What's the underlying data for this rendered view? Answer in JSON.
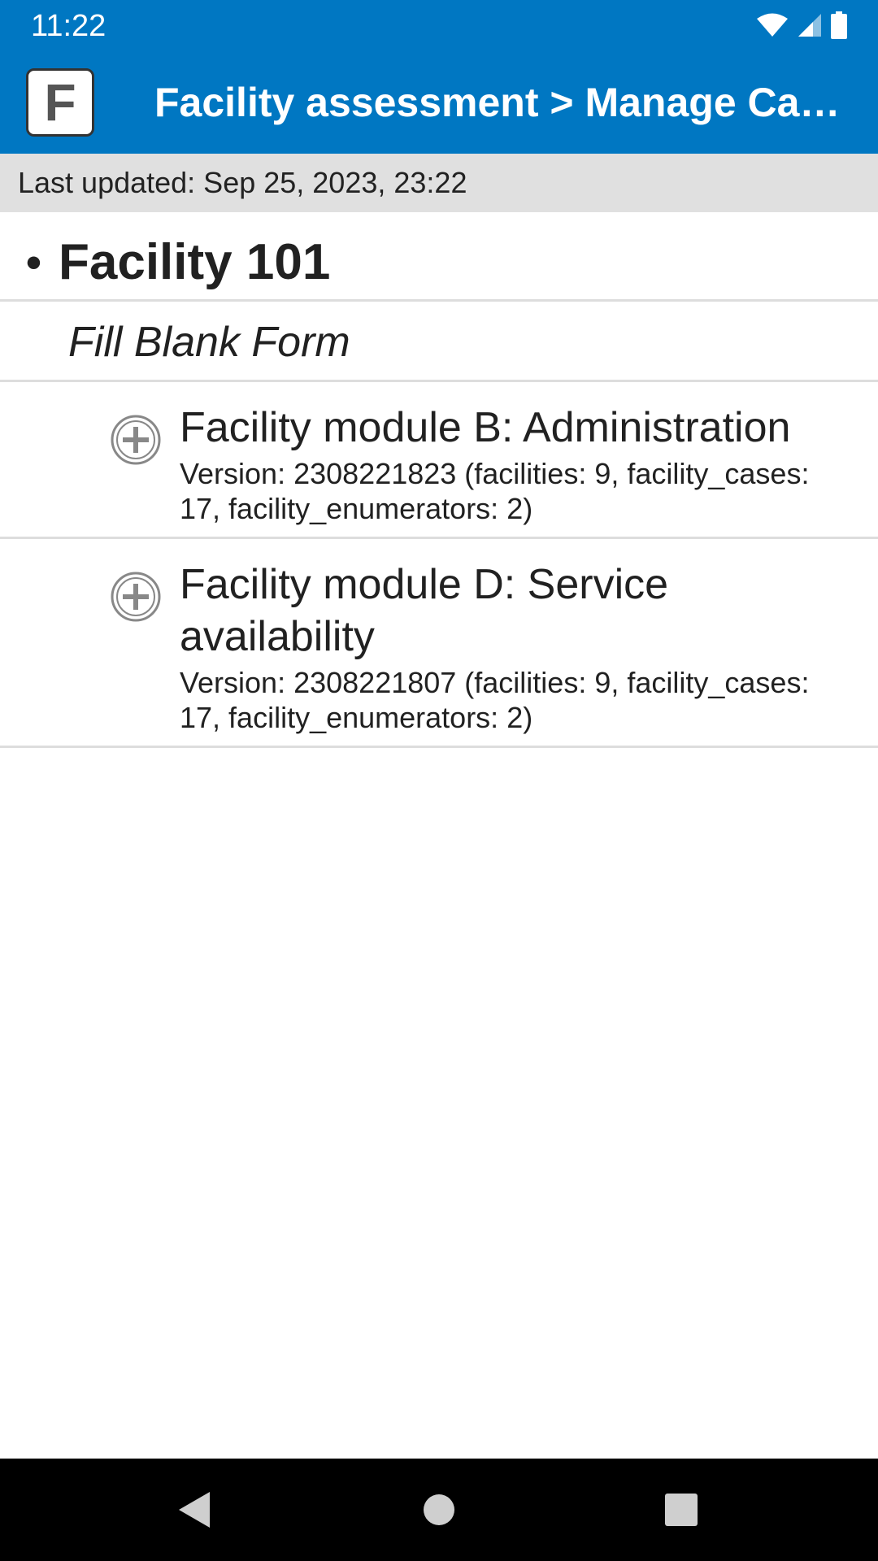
{
  "status_bar": {
    "time": "11:22",
    "icons": [
      "wifi-icon",
      "signal-icon",
      "battery-icon"
    ]
  },
  "app_bar": {
    "logo_letter": "F",
    "title": "Facility assessment > Manage Ca…",
    "color": "#0077c2"
  },
  "last_updated": "Last updated: Sep 25, 2023, 23:22",
  "facility": {
    "name": "Facility 101"
  },
  "fill_blank_label": "Fill Blank Form",
  "forms": [
    {
      "title": "Facility module B: Administration",
      "version": "Version: 2308221823 (facilities: 9, facility_cases: 17, facility_enumerators: 2)"
    },
    {
      "title": "Facility module D: Service availability",
      "version": "Version: 2308221807 (facilities: 9, facility_cases: 17, facility_enumerators: 2)"
    }
  ],
  "nav_bar": {
    "buttons": [
      "back-icon",
      "home-icon",
      "recents-icon"
    ]
  }
}
